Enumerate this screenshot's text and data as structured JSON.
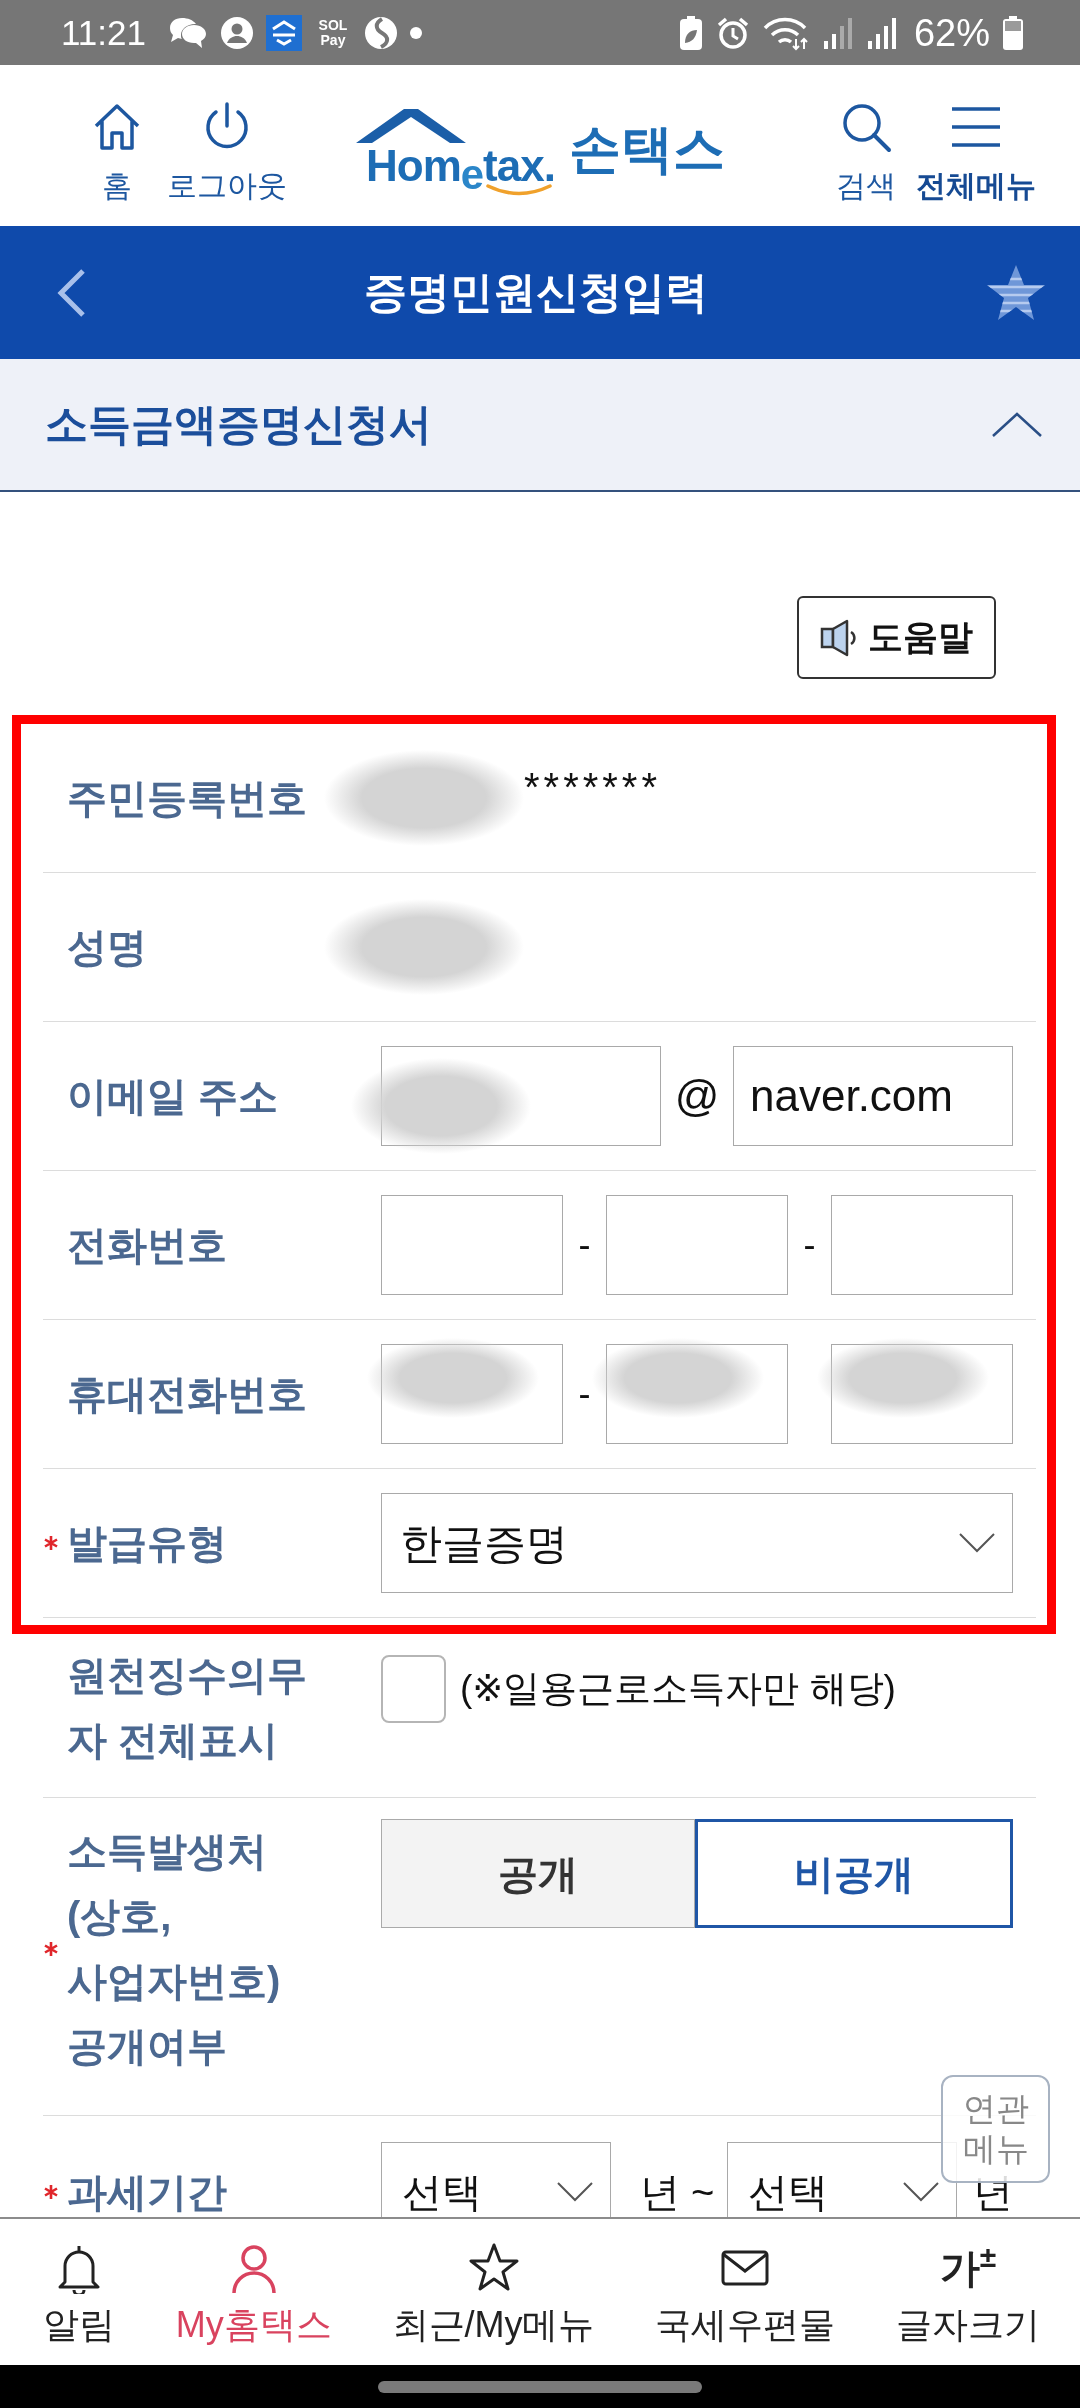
{
  "status_bar": {
    "time": "11:21",
    "notification_icons": [
      {
        "kind": "chat"
      },
      {
        "kind": "person"
      },
      {
        "kind": "bank"
      },
      {
        "kind": "pay",
        "label": "SOL Pay"
      },
      {
        "kind": "swirl"
      },
      {
        "kind": "dot"
      }
    ],
    "system_icons": [
      {
        "kind": "battery-saver"
      },
      {
        "kind": "alarm"
      },
      {
        "kind": "wifi"
      },
      {
        "kind": "roaming-signal"
      },
      {
        "kind": "signal"
      }
    ],
    "battery": "62%"
  },
  "header": {
    "left_buttons": [
      {
        "kind": "home",
        "label": "홈"
      },
      {
        "kind": "logout",
        "label": "로그아웃"
      }
    ],
    "logo": {
      "wordmark": "Hom$_{e}$tax.",
      "name": "손택스"
    },
    "right_buttons": [
      {
        "kind": "search",
        "label": "검색"
      },
      {
        "kind": "menu",
        "label": "전체메뉴"
      }
    ]
  },
  "title_bar": {
    "title": "증명민원신청입력"
  },
  "section": {
    "title": "소득금액증명신청서",
    "expanded": true
  },
  "help_button": {
    "label": "도움말"
  },
  "form": {
    "marked_group": {
      "rows": [
        {
          "kind": "text",
          "label": "주민등록번호",
          "required": false,
          "redacted": true,
          "value": "*******"
        },
        {
          "kind": "text",
          "label": "성명",
          "required": false,
          "redacted": true
        },
        {
          "kind": "email",
          "label": "이메일 주소",
          "required": false,
          "local_part": {
            "redacted": true
          },
          "at": "@",
          "domain": "naver.com"
        },
        {
          "kind": "phone",
          "label": "전화번호",
          "required": false,
          "parts": [
            {
              "redacted": false
            },
            {
              "separator": "-",
              "redacted": false
            },
            {
              "separator": "-",
              "redacted": false
            }
          ]
        },
        {
          "kind": "phone",
          "label": "휴대전화번호",
          "required": false,
          "parts": [
            {
              "redacted": true
            },
            {
              "separator": "-",
              "redacted": true
            },
            {
              "redacted": true
            }
          ]
        },
        {
          "kind": "select",
          "label": "발급유형",
          "required": true,
          "value": "한글증명"
        }
      ]
    },
    "rows": [
      {
        "kind": "checkbox",
        "label": "원천징수의무자 전체표시",
        "required": false,
        "checked": false,
        "text": "(※일용근로소득자만 해당)"
      },
      {
        "kind": "segmented",
        "label": "소득발생처 (상호, 사업자번호) 공개여부",
        "required": true,
        "options": [
          {
            "label": "공개",
            "selected": false
          },
          {
            "label": "비공개",
            "selected": true
          }
        ]
      },
      {
        "kind": "period",
        "label": "과세기간",
        "required": true,
        "from": "선택",
        "from_unit": "년 ~",
        "to": "선택",
        "to_unit": "년"
      }
    ]
  },
  "floating_button": {
    "label": "연관메뉴"
  },
  "bottom_nav": {
    "items": [
      {
        "kind": "bell",
        "label": "알림",
        "selected": false
      },
      {
        "kind": "person",
        "label": "My홈택스",
        "selected": true
      },
      {
        "kind": "star",
        "label": "최근/My메뉴",
        "selected": false
      },
      {
        "kind": "mail",
        "label": "국세우편물",
        "selected": false
      },
      {
        "kind": "font-size",
        "icon_text": "가$^{±}$",
        "label": "글자크기",
        "selected": false
      }
    ]
  }
}
